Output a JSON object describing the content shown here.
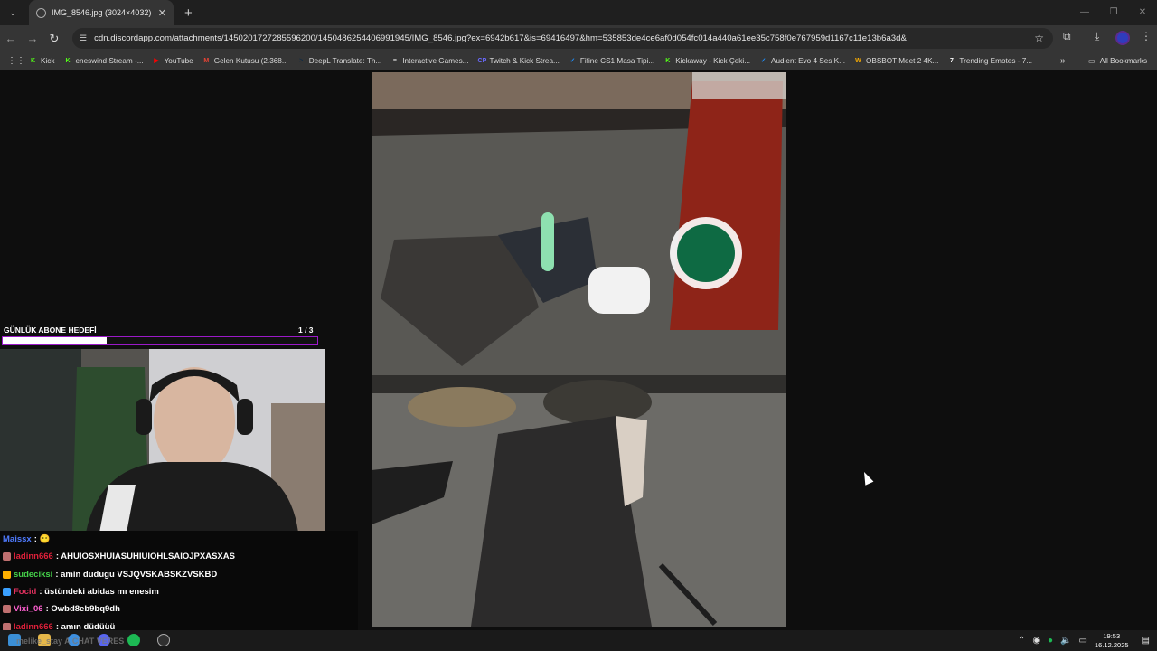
{
  "tab": {
    "title": "IMG_8546.jpg (3024×4032)",
    "close": "✕"
  },
  "address": {
    "url": "cdn.discordapp.com/attachments/1450201727285596200/1450486254406991945/IMG_8546.jpg?ex=6942b617&is=69416497&hm=535853de4ce6af0d054fc014a440a61ee35c758f0e767959d1167c11e13b6a3d&"
  },
  "bookmarks": [
    {
      "label": "Kick",
      "icon": "K",
      "color": "#53fc18"
    },
    {
      "label": "eneswind Stream -...",
      "icon": "K",
      "color": "#53fc18"
    },
    {
      "label": "YouTube",
      "icon": "▶",
      "color": "#ff0000"
    },
    {
      "label": "Gelen Kutusu (2.368...",
      "icon": "M",
      "color": "#ea4335"
    },
    {
      "label": "DeepL Translate: Th...",
      "icon": ">",
      "color": "#0f2b46"
    },
    {
      "label": "Interactive Games...",
      "icon": "≡",
      "color": "#ffffff"
    },
    {
      "label": "Twitch & Kick Strea...",
      "icon": "CP",
      "color": "#6a6aff"
    },
    {
      "label": "Fifine CS1 Masa Tipi...",
      "icon": "✓",
      "color": "#1e90ff"
    },
    {
      "label": "Kickaway - Kick Çeki...",
      "icon": "K",
      "color": "#53fc18"
    },
    {
      "label": "Audient Evo 4 Ses K...",
      "icon": "✓",
      "color": "#1e90ff"
    },
    {
      "label": "OBSBOT Meet 2 4K...",
      "icon": "W",
      "color": "#ffb000"
    },
    {
      "label": "Trending Emotes - 7...",
      "icon": "7",
      "color": "#ffffff"
    }
  ],
  "all_bookmarks": "All Bookmarks",
  "overlay": {
    "goal_label": "GÜNLÜK ABONE HEDEFİ",
    "goal_count": "1  / 3",
    "goal_progress": 0.33
  },
  "chat": [
    {
      "user": "Maissx",
      "color": "#4f7bff",
      "text": " : 😶",
      "badge": ""
    },
    {
      "user": "ladinn666",
      "color": "#e0203a",
      "text": " : AHUIOSXHUIASUHIUIOHLSAIOJPXASXAS",
      "badge": "#c07070"
    },
    {
      "user": "sudeciksi",
      "color": "#45d24a",
      "text": " : amin dudugu VSJQVSKABSKZVSKBD",
      "badge": "#ffb000"
    },
    {
      "user": "Focid",
      "color": "#e3315f",
      "text": " : üstündeki abidas mı enesim",
      "badge": "#3aa0ff"
    },
    {
      "user": "Vixi_06",
      "color": "#ff5fd0",
      "text": " : Owbd8eb9bq9dh",
      "badge": "#c07070"
    },
    {
      "user": "ladinn666",
      "color": "#e0203a",
      "text": " : amın düdüüü",
      "badge": "#c07070"
    }
  ],
  "taskbar": {
    "time": "19:53",
    "date": "16.12.2025",
    "overlay_text": "melike_stay  A CHAT VERES"
  }
}
